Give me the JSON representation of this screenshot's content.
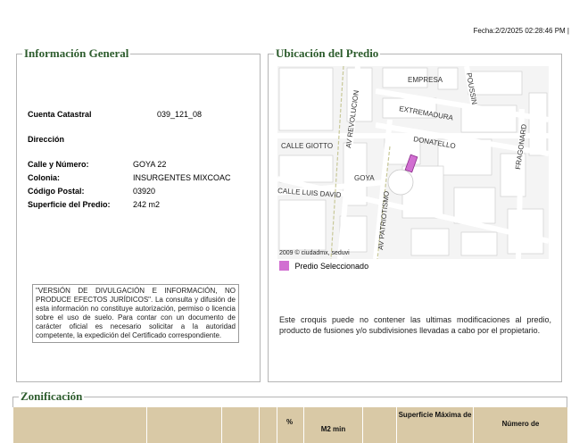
{
  "fecha": "Fecha:2/2/2025 02:28:46 PM |",
  "general": {
    "legend": "Información General",
    "cuenta_label": "Cuenta Catastral",
    "cuenta_value": "039_121_08",
    "direccion_label": "Dirección",
    "calle_label": "Calle y Número:",
    "calle_value": "GOYA 22",
    "colonia_label": "Colonia:",
    "colonia_value": "INSURGENTES MIXCOAC",
    "cp_label": "Código Postal:",
    "cp_value": "03920",
    "superficie_label": "Superficie del Predio:",
    "superficie_value": "242 m2",
    "disclaimer": "\"VERSIÓN DE DIVULGACIÓN E INFORMACIÓN, NO PRODUCE EFECTOS JURÍDICOS\". La consulta y difusión de esta información no constituye autorización, permiso o licencia sobre el uso de suelo. Para contar con un documento de carácter oficial es necesario solicitar a la autoridad competente, la expedición del Certificado correspondiente."
  },
  "ubicacion": {
    "legend": "Ubicación del Predio",
    "streets": {
      "empresa": "EMPRESA",
      "poussin": "POUSSIN",
      "revolucion": "AV REVOLUCION",
      "extremadura": "EXTREMADURA",
      "donatello": "DONATELLO",
      "fragonard": "FRAGONARD",
      "giotto": "CALLE GIOTTO",
      "goya": "GOYA",
      "luis_david": "CALLE LUIS DAVID",
      "patriotismo": "AV PATRIOTISMO"
    },
    "map_attribution": "2009 © ciudadmx, seduvi",
    "legend_label": "Predio Seleccionado",
    "legend_color": "#d16fd1",
    "note": "Este croquis puede no contener las ultimas modificaciones al predio, producto de fusiones y/o subdivisiones llevadas a cabo por el propietario."
  },
  "zonificacion": {
    "legend": "Zonificación",
    "col_pct": "%",
    "col_m2min": "M2 min",
    "col_superficie": "Superficie Máxima de",
    "col_numero": "Número de"
  }
}
